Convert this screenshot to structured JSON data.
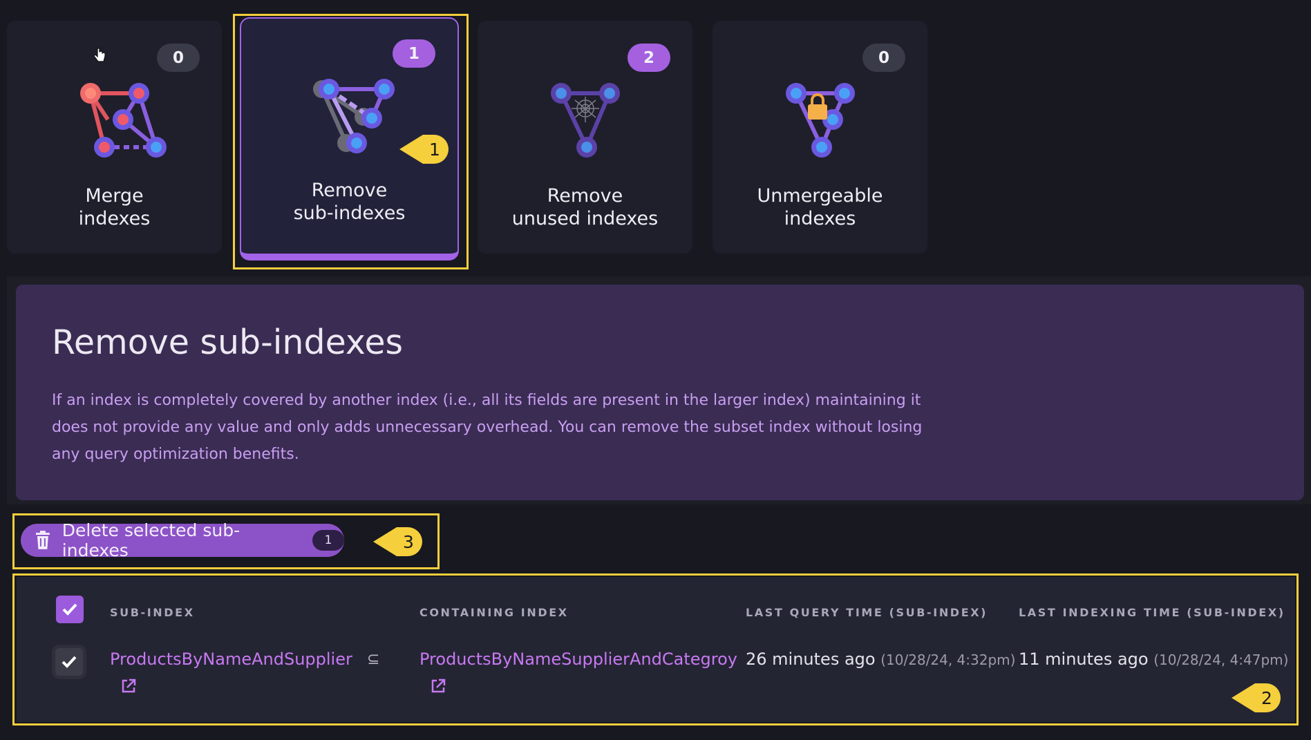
{
  "cards": [
    {
      "label": "Merge\nindexes",
      "count": "0",
      "icon": "merge-indexes-icon"
    },
    {
      "label": "Remove\nsub-indexes",
      "count": "1",
      "icon": "sub-indexes-icon"
    },
    {
      "label": "Remove\nunused indexes",
      "count": "2",
      "icon": "unused-indexes-icon"
    },
    {
      "label": "Unmergeable\nindexes",
      "count": "0",
      "icon": "unmergeable-indexes-icon"
    }
  ],
  "callouts": [
    "1",
    "2",
    "3"
  ],
  "info": {
    "title": "Remove sub-indexes",
    "description": "If an index is completely covered by another index (i.e., all its fields are present in the larger index) maintaining it does not provide any value and only adds unnecessary overhead. You can remove the subset index without losing any query optimization benefits."
  },
  "delete_button": {
    "label": "Delete selected sub-indexes",
    "count": "1",
    "icon": "trash-icon"
  },
  "table": {
    "headers": {
      "sub_index": "SUB-INDEX",
      "containing_index": "CONTAINING INDEX",
      "last_query": "LAST QUERY TIME (SUB-INDEX)",
      "last_indexing": "LAST INDEXING TIME (SUB-INDEX)"
    },
    "rows": [
      {
        "sub_index": "ProductsByNameAndSupplier",
        "relation": "⊆",
        "containing_index": "ProductsByNameSupplierAndCategroy",
        "last_query": "26 minutes ago",
        "last_query_date": "(10/28/24, 4:32pm)",
        "last_indexing": "11 minutes ago",
        "last_indexing_date": "(10/28/24, 4:47pm)",
        "selected": true
      }
    ]
  },
  "colors": {
    "accent": "#a263e8",
    "highlight": "#f5cf3c",
    "panel": "#3b2c54",
    "link": "#c779f2"
  }
}
